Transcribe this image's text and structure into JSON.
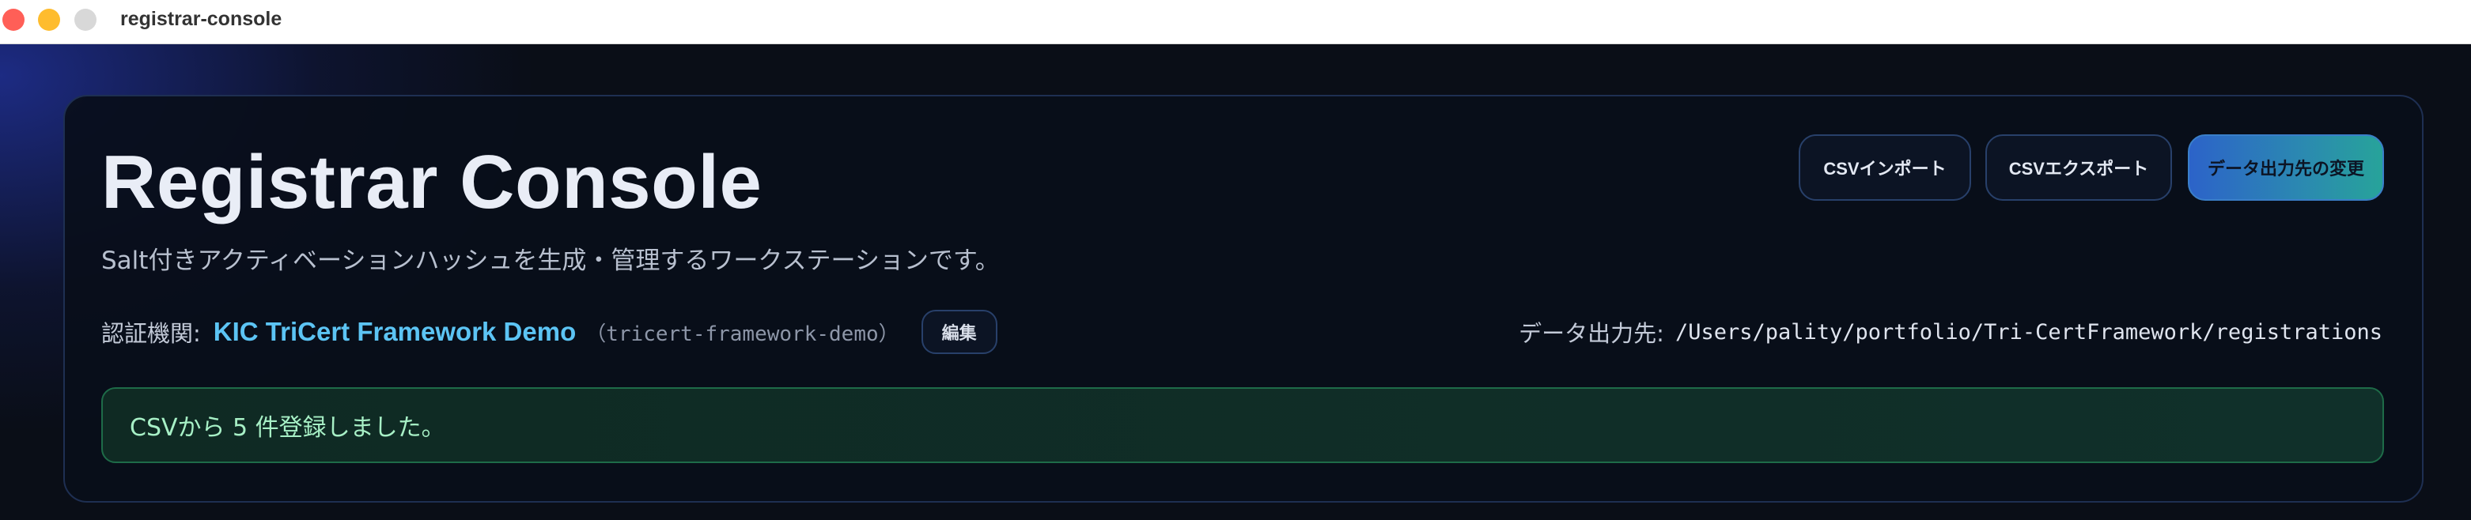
{
  "window": {
    "title": "registrar-console"
  },
  "header": {
    "title": "Registrar Console",
    "subtitle": "Salt付きアクティベーションハッシュを生成・管理するワークステーションです。"
  },
  "toolbar": {
    "import_label": "CSVインポート",
    "export_label": "CSVエクスポート",
    "change_destination_label": "データ出力先の変更"
  },
  "authority": {
    "label": "認証機関:",
    "name": "KIC TriCert Framework Demo",
    "id": "（tricert-framework-demo）",
    "edit_label": "編集"
  },
  "output": {
    "label": "データ出力先:",
    "path": "/Users/pality/portfolio/Tri-CertFramework/registrations"
  },
  "alert": {
    "message": "CSVから 5 件登録しました。"
  },
  "colors": {
    "accent": "#5cc4f4",
    "success": "#a7f0c6",
    "background": "#0a0e17"
  }
}
